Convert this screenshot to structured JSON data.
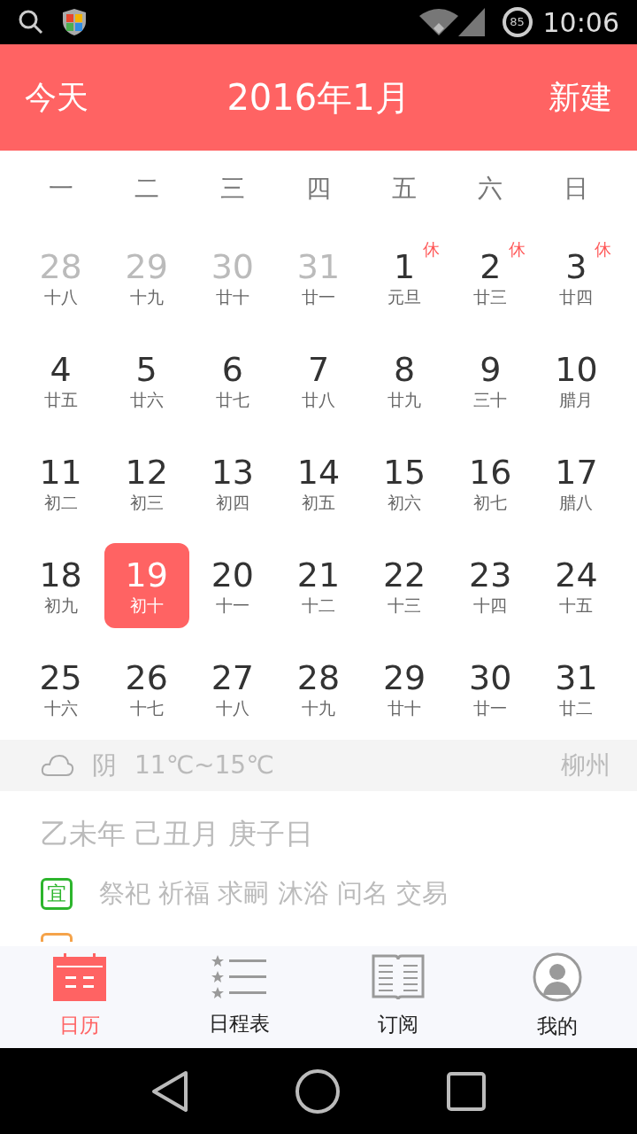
{
  "status_bar": {
    "battery": "85",
    "time": "10:06"
  },
  "header": {
    "today": "今天",
    "title": "2016年1月",
    "new": "新建"
  },
  "weekdays": [
    "一",
    "二",
    "三",
    "四",
    "五",
    "六",
    "日"
  ],
  "weeks": [
    [
      {
        "day": "28",
        "lunar": "十八",
        "muted": true,
        "selected": false
      },
      {
        "day": "29",
        "lunar": "十九",
        "muted": true,
        "selected": false
      },
      {
        "day": "30",
        "lunar": "廿十",
        "muted": true,
        "selected": false
      },
      {
        "day": "31",
        "lunar": "廿一",
        "muted": true,
        "selected": false
      },
      {
        "day": "1",
        "lunar": "元旦",
        "muted": false,
        "selected": false,
        "badge": "休"
      },
      {
        "day": "2",
        "lunar": "廿三",
        "muted": false,
        "selected": false,
        "badge": "休"
      },
      {
        "day": "3",
        "lunar": "廿四",
        "muted": false,
        "selected": false,
        "badge": "休"
      }
    ],
    [
      {
        "day": "4",
        "lunar": "廿五",
        "muted": false,
        "selected": false
      },
      {
        "day": "5",
        "lunar": "廿六",
        "muted": false,
        "selected": false
      },
      {
        "day": "6",
        "lunar": "廿七",
        "muted": false,
        "selected": false
      },
      {
        "day": "7",
        "lunar": "廿八",
        "muted": false,
        "selected": false
      },
      {
        "day": "8",
        "lunar": "廿九",
        "muted": false,
        "selected": false
      },
      {
        "day": "9",
        "lunar": "三十",
        "muted": false,
        "selected": false
      },
      {
        "day": "10",
        "lunar": "腊月",
        "muted": false,
        "selected": false
      }
    ],
    [
      {
        "day": "11",
        "lunar": "初二",
        "muted": false,
        "selected": false
      },
      {
        "day": "12",
        "lunar": "初三",
        "muted": false,
        "selected": false
      },
      {
        "day": "13",
        "lunar": "初四",
        "muted": false,
        "selected": false
      },
      {
        "day": "14",
        "lunar": "初五",
        "muted": false,
        "selected": false
      },
      {
        "day": "15",
        "lunar": "初六",
        "muted": false,
        "selected": false
      },
      {
        "day": "16",
        "lunar": "初七",
        "muted": false,
        "selected": false
      },
      {
        "day": "17",
        "lunar": "腊八",
        "muted": false,
        "selected": false
      }
    ],
    [
      {
        "day": "18",
        "lunar": "初九",
        "muted": false,
        "selected": false
      },
      {
        "day": "19",
        "lunar": "初十",
        "muted": false,
        "selected": true
      },
      {
        "day": "20",
        "lunar": "十一",
        "muted": false,
        "selected": false
      },
      {
        "day": "21",
        "lunar": "十二",
        "muted": false,
        "selected": false
      },
      {
        "day": "22",
        "lunar": "十三",
        "muted": false,
        "selected": false
      },
      {
        "day": "23",
        "lunar": "十四",
        "muted": false,
        "selected": false
      },
      {
        "day": "24",
        "lunar": "十五",
        "muted": false,
        "selected": false
      }
    ],
    [
      {
        "day": "25",
        "lunar": "十六",
        "muted": false,
        "selected": false
      },
      {
        "day": "26",
        "lunar": "十七",
        "muted": false,
        "selected": false
      },
      {
        "day": "27",
        "lunar": "十八",
        "muted": false,
        "selected": false
      },
      {
        "day": "28",
        "lunar": "十九",
        "muted": false,
        "selected": false
      },
      {
        "day": "29",
        "lunar": "廿十",
        "muted": false,
        "selected": false
      },
      {
        "day": "30",
        "lunar": "廿一",
        "muted": false,
        "selected": false
      },
      {
        "day": "31",
        "lunar": "廿二",
        "muted": false,
        "selected": false
      }
    ]
  ],
  "weather": {
    "condition": "阴",
    "temperature": "11℃~15℃",
    "city": "柳州"
  },
  "almanac": {
    "ganzhi": "乙未年 己丑月 庚子日",
    "good_mark": "宜",
    "good": "祭祀 祈福 求嗣 沐浴 问名 交易"
  },
  "tabs": [
    {
      "kind": "calendar",
      "label": "日历",
      "selected": true
    },
    {
      "kind": "schedule",
      "label": "日程表",
      "selected": false
    },
    {
      "kind": "subscribe",
      "label": "订阅",
      "selected": false
    },
    {
      "kind": "profile",
      "label": "我的",
      "selected": false
    }
  ]
}
